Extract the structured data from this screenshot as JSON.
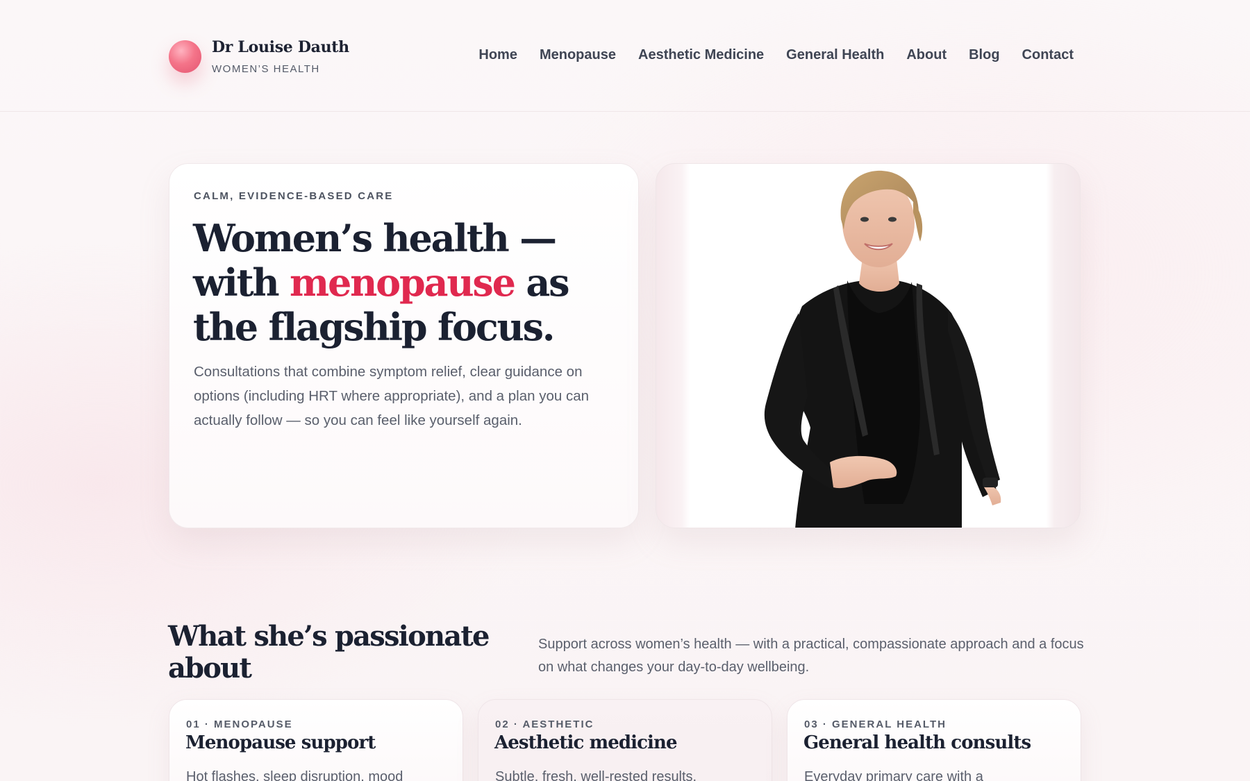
{
  "brand": {
    "name": "Dr Louise Dauth",
    "subtitle": "WOMEN’S HEALTH"
  },
  "nav": {
    "items": [
      {
        "label": "Home"
      },
      {
        "label": "Menopause"
      },
      {
        "label": "Aesthetic Medicine"
      },
      {
        "label": "General Health"
      },
      {
        "label": "About"
      },
      {
        "label": "Blog"
      },
      {
        "label": "Contact"
      }
    ]
  },
  "hero": {
    "eyebrow": "CALM, EVIDENCE-BASED CARE",
    "title_part1": "Women’s health — with ",
    "title_accent": "menopause",
    "title_part2": " as the flagship focus.",
    "body": "Consultations that combine symptom relief, clear guidance on options (including HRT where appropriate), and a plan you can actually follow — so you can feel like yourself again."
  },
  "section": {
    "title": "What she’s passionate about",
    "lede": "Support across women’s health — with a practical, compassionate approach and a focus on what changes your day-to-day wellbeing."
  },
  "cards": [
    {
      "kicker": "01 · MENOPAUSE",
      "title": "Menopause support",
      "text": "Hot flashes, sleep disruption, mood"
    },
    {
      "kicker": "02 · AESTHETIC",
      "title": "Aesthetic medicine",
      "text": "Subtle, fresh, well-rested results."
    },
    {
      "kicker": "03 · GENERAL HEALTH",
      "title": "General health consults",
      "text": "Everyday primary care with a"
    }
  ],
  "colors": {
    "accent": "#e0294f",
    "text": "#1b2131",
    "muted": "#5a5f6c",
    "background": "#fbf6f7"
  }
}
